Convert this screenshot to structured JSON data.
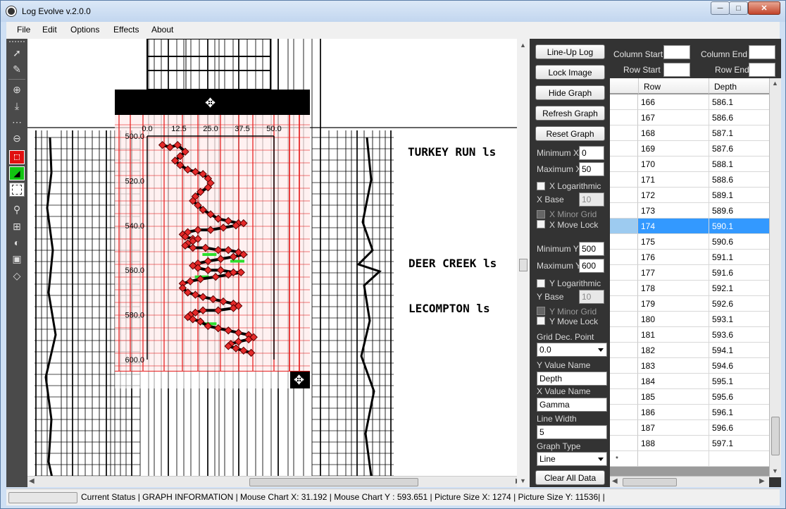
{
  "window": {
    "title": "Log Evolve v.2.0.0"
  },
  "menu": [
    "File",
    "Edit",
    "Options",
    "Effects",
    "About"
  ],
  "tools": [
    "arrow-select-icon",
    "pen-icon",
    "zoom-in-icon",
    "move-down-icon",
    "add-point-icon",
    "zoom-out-icon",
    "red-box-icon",
    "green-diagonal-icon",
    "marquee-select-icon",
    "magnifier-icon",
    "crop-icon",
    "contrast-icon",
    "camera-icon",
    "diamond-icon"
  ],
  "log_image": {
    "labels": [
      "TURKEY RUN ls",
      "DEER CREEK ls",
      "LECOMPTON ls"
    ]
  },
  "chart_data": {
    "type": "line",
    "x_ticks": [
      "0.0",
      "12.5",
      "25.0",
      "37.5",
      "50.0"
    ],
    "y_ticks": [
      "500.0",
      "520.0",
      "540.0",
      "560.0",
      "580.0",
      "600.0"
    ],
    "xlim": [
      0,
      50
    ],
    "ylim": [
      500,
      600
    ],
    "y_inverted": true,
    "series": [
      {
        "values": [
          [
            6,
            504
          ],
          [
            9,
            505
          ],
          [
            12,
            504
          ],
          [
            15,
            507
          ],
          [
            13,
            509
          ],
          [
            11,
            511
          ],
          [
            13,
            513
          ],
          [
            16,
            515
          ],
          [
            19,
            516
          ],
          [
            22,
            517
          ],
          [
            24,
            519
          ],
          [
            25,
            521
          ],
          [
            24,
            523
          ],
          [
            21,
            525
          ],
          [
            19,
            527
          ],
          [
            18,
            529
          ],
          [
            20,
            531
          ],
          [
            22,
            533
          ],
          [
            25,
            535
          ],
          [
            28,
            537
          ],
          [
            32,
            538
          ],
          [
            36,
            539
          ],
          [
            38,
            539
          ],
          [
            35,
            540
          ],
          [
            30,
            541
          ],
          [
            25,
            542
          ],
          [
            20,
            542
          ],
          [
            16,
            543
          ],
          [
            14,
            544
          ],
          [
            15,
            545
          ],
          [
            18,
            546
          ],
          [
            20,
            546
          ],
          [
            18,
            547
          ],
          [
            16,
            548
          ],
          [
            15,
            549
          ],
          [
            18,
            550
          ],
          [
            23,
            550
          ],
          [
            28,
            551
          ],
          [
            32,
            551
          ],
          [
            36,
            552
          ],
          [
            38,
            553
          ],
          [
            34,
            554
          ],
          [
            29,
            555
          ],
          [
            24,
            556
          ],
          [
            20,
            557
          ],
          [
            18,
            558
          ],
          [
            20,
            559
          ],
          [
            24,
            560
          ],
          [
            29,
            560
          ],
          [
            34,
            561
          ],
          [
            37,
            561
          ],
          [
            32,
            562
          ],
          [
            27,
            563
          ],
          [
            21,
            564
          ],
          [
            17,
            565
          ],
          [
            14,
            566
          ],
          [
            14,
            568
          ],
          [
            16,
            570
          ],
          [
            19,
            571
          ],
          [
            22,
            572
          ],
          [
            26,
            573
          ],
          [
            30,
            574
          ],
          [
            34,
            575
          ],
          [
            36,
            576
          ],
          [
            34,
            577
          ],
          [
            28,
            578
          ],
          [
            22,
            578
          ],
          [
            19,
            579
          ],
          [
            17,
            580
          ],
          [
            16,
            581
          ],
          [
            18,
            582
          ],
          [
            21,
            583
          ],
          [
            24,
            585
          ],
          [
            28,
            586
          ],
          [
            32,
            587
          ],
          [
            36,
            588
          ],
          [
            40,
            589
          ],
          [
            42,
            590
          ],
          [
            40,
            591
          ],
          [
            36,
            592
          ],
          [
            33,
            593
          ],
          [
            32,
            594
          ],
          [
            35,
            595
          ],
          [
            38,
            596
          ],
          [
            41,
            597
          ]
        ]
      }
    ],
    "line_color": "#000000",
    "marker_color": "#e52a2a"
  },
  "sidebar": {
    "buttons": {
      "lineup": "Line-Up Log",
      "lock": "Lock Image",
      "hide": "Hide Graph",
      "refresh": "Refresh Graph",
      "reset": "Reset Graph",
      "clear": "Clear All Data"
    },
    "min_x_label": "Minimum X",
    "min_x": "0",
    "max_x_label": "Maximum X",
    "max_x": "50",
    "x_log_label": "X Logarithmic",
    "x_base_label": "X Base",
    "x_base": "10",
    "x_minor_label": "X Minor Grid",
    "x_move_lock_label": "X Move Lock",
    "min_y_label": "Minimum Y",
    "min_y": "500",
    "max_y_label": "Maximum Y",
    "max_y": "600",
    "y_log_label": "Y Logarithmic",
    "y_base_label": "Y Base",
    "y_base": "10",
    "y_minor_label": "Y Minor Grid",
    "y_move_lock_label": "Y Move Lock",
    "grid_dec_label": "Grid Dec. Point",
    "grid_dec": "0.0",
    "y_name_label": "Y Value Name",
    "y_name": "Depth",
    "x_name_label": "X Value Name",
    "x_name": "Gamma",
    "line_width_label": "Line Width",
    "line_width": "5",
    "graph_type_label": "Graph Type",
    "graph_type": "Line"
  },
  "right_panel": {
    "column_start": "Column Start",
    "column_end": "Column End",
    "row_start": "Row Start",
    "row_end": "Row End"
  },
  "table": {
    "headers": [
      "Row",
      "Depth"
    ],
    "rows": [
      [
        "166",
        "586.1"
      ],
      [
        "167",
        "586.6"
      ],
      [
        "168",
        "587.1"
      ],
      [
        "169",
        "587.6"
      ],
      [
        "170",
        "588.1"
      ],
      [
        "171",
        "588.6"
      ],
      [
        "172",
        "589.1"
      ],
      [
        "173",
        "589.6"
      ],
      [
        "174",
        "590.1"
      ],
      [
        "175",
        "590.6"
      ],
      [
        "176",
        "591.1"
      ],
      [
        "177",
        "591.6"
      ],
      [
        "178",
        "592.1"
      ],
      [
        "179",
        "592.6"
      ],
      [
        "180",
        "593.1"
      ],
      [
        "181",
        "593.6"
      ],
      [
        "182",
        "594.1"
      ],
      [
        "183",
        "594.6"
      ],
      [
        "184",
        "595.1"
      ],
      [
        "185",
        "595.6"
      ],
      [
        "186",
        "596.1"
      ],
      [
        "187",
        "596.6"
      ],
      [
        "188",
        "597.1"
      ]
    ],
    "selected_row": "174",
    "new_row_marker": "*"
  },
  "status": {
    "text": "Current Status  |  GRAPH INFORMATION  |  Mouse Chart X: 31.192  | Mouse Chart Y : 593.651  | Picture Size X: 1274  |  Picture Size Y: 11536| |"
  }
}
